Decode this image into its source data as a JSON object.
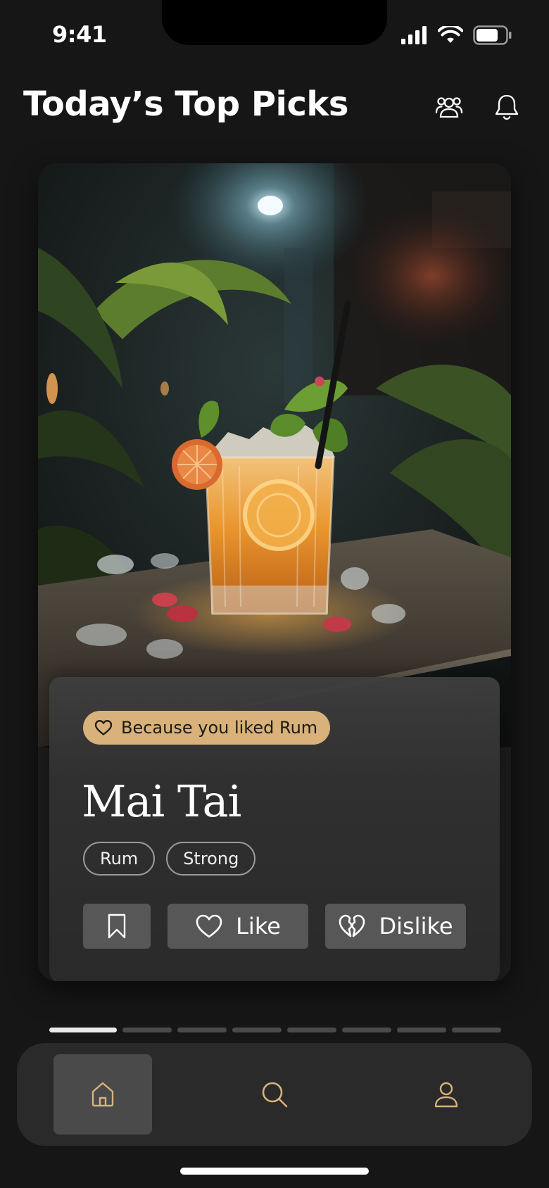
{
  "status_bar": {
    "time": "9:41"
  },
  "header": {
    "title": "Today’s Top Picks"
  },
  "card": {
    "reason": "Because you liked Rum",
    "name": "Mai Tai",
    "tags": [
      "Rum",
      "Strong"
    ],
    "actions": {
      "like_label": "Like",
      "dislike_label": "Dislike"
    }
  },
  "pager": {
    "total": 8,
    "current": 1
  },
  "tabs": [
    {
      "icon": "home-icon",
      "active": true
    },
    {
      "icon": "search-icon",
      "active": false
    },
    {
      "icon": "user-icon",
      "active": false
    }
  ],
  "colors": {
    "accent": "#d8b27a",
    "background": "#161616",
    "panel": "#2f2f2f"
  }
}
